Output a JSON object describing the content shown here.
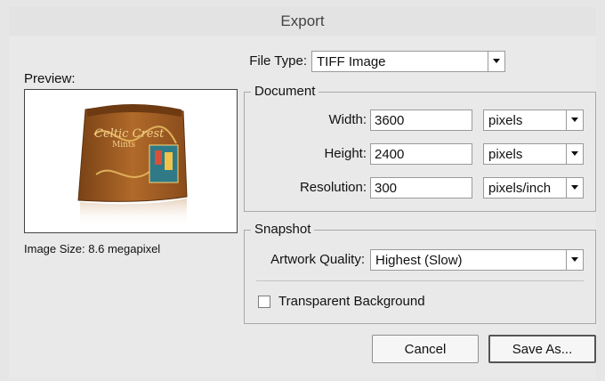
{
  "window": {
    "title": "Export"
  },
  "preview": {
    "label": "Preview:",
    "image_size": "Image Size: 8.6 megapixel",
    "product_text_top": "Celtic Crest",
    "product_text_sub": "Mints"
  },
  "file_type": {
    "label": "File Type:",
    "value": "TIFF Image"
  },
  "document": {
    "legend": "Document",
    "width": {
      "label": "Width:",
      "value": "3600",
      "unit": "pixels"
    },
    "height": {
      "label": "Height:",
      "value": "2400",
      "unit": "pixels"
    },
    "resolution": {
      "label": "Resolution:",
      "value": "300",
      "unit": "pixels/inch"
    }
  },
  "snapshot": {
    "legend": "Snapshot",
    "artwork_quality": {
      "label": "Artwork Quality:",
      "value": "Highest (Slow)"
    },
    "transparent_background": {
      "label": "Transparent Background",
      "checked": false
    }
  },
  "buttons": {
    "cancel": "Cancel",
    "save_as": "Save As..."
  },
  "colors": {
    "package_brown": "#9a5a22",
    "package_gold": "#d9a255"
  }
}
